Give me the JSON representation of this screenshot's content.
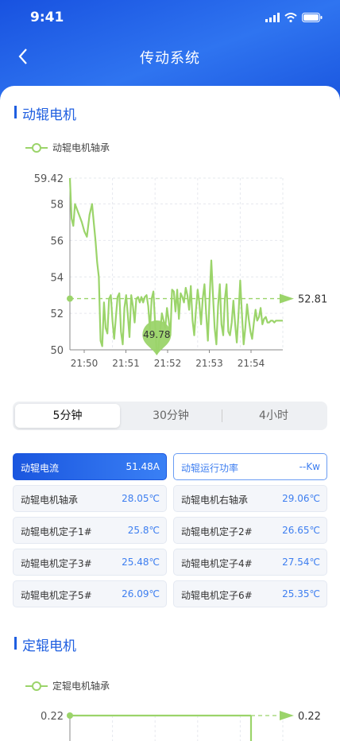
{
  "status_bar": {
    "time": "9:41"
  },
  "nav": {
    "title": "传动系统"
  },
  "section1": {
    "title": "动辊电机",
    "legend": "动辊电机轴承",
    "chart_data": {
      "type": "line",
      "series": [
        {
          "name": "动辊电机轴承",
          "x": [
            0,
            0.2,
            0.4,
            0.6,
            1.0,
            1.4,
            1.7,
            2.0,
            2.3,
            2.6,
            2.8,
            3.0,
            3.2,
            3.4,
            3.6,
            3.8,
            4.0,
            4.2,
            4.4,
            4.6,
            4.8,
            5.0,
            5.2,
            5.4,
            5.6,
            5.8,
            6.0,
            6.2,
            6.4,
            6.6,
            6.8,
            7.0,
            7.2,
            7.4,
            7.6,
            7.8,
            8.0,
            8.2,
            8.4,
            8.6,
            8.8,
            9.0,
            9.2,
            9.4,
            9.6,
            9.8,
            10.0,
            10.2,
            10.4,
            10.6,
            10.8,
            11.0,
            11.2,
            11.4,
            11.6,
            11.8,
            12.0,
            12.2,
            12.4,
            12.6,
            12.8,
            13.0,
            13.2,
            13.4,
            13.6,
            13.8,
            14.0,
            14.2,
            14.4,
            14.6,
            14.8,
            15.0,
            15.2,
            15.4,
            15.6,
            15.8,
            16.0,
            16.2,
            16.4,
            16.6,
            16.8,
            17.0,
            17.2,
            17.4,
            17.6,
            17.8,
            18.0,
            18.2,
            18.4,
            18.6,
            18.8,
            19.0,
            19.2,
            19.4,
            19.6,
            19.8,
            20.0,
            20.2,
            20.4,
            20.6,
            20.8,
            21.0,
            21.2,
            21.4,
            21.6,
            21.8,
            22.0,
            22.2,
            22.4,
            22.6,
            22.8,
            23.0,
            23.2,
            23.4,
            23.6,
            23.8,
            24.0,
            24.2,
            24.4,
            24.6,
            24.8,
            25.0
          ],
          "values": [
            59.42,
            57.2,
            56.8,
            58.0,
            57.5,
            57.0,
            56.5,
            56.2,
            57.4,
            58.0,
            57.0,
            56.0,
            54.8,
            54.0,
            50.5,
            50.2,
            52.6,
            51.2,
            50.9,
            52.8,
            53.0,
            51.6,
            50.6,
            51.8,
            52.9,
            53.1,
            51.0,
            50.3,
            52.3,
            53.0,
            51.9,
            50.7,
            53.0,
            52.4,
            51.5,
            52.8,
            52.9,
            52.6,
            52.9,
            52.6,
            52.9,
            53.0,
            52.4,
            51.1,
            52.8,
            53.2,
            51.5,
            49.78,
            50.1,
            51.0,
            52.0,
            51.6,
            51.2,
            52.3,
            51.6,
            50.8,
            53.3,
            53.2,
            52.1,
            53.3,
            51.7,
            53.1,
            52.9,
            52.6,
            53.4,
            53.0,
            52.2,
            53.5,
            51.6,
            50.8,
            52.2,
            53.3,
            52.6,
            51.4,
            52.8,
            53.6,
            52.0,
            50.5,
            52.8,
            54.9,
            53.0,
            51.2,
            50.3,
            52.4,
            53.6,
            51.4,
            50.8,
            52.8,
            53.6,
            51.0,
            50.8,
            51.5,
            52.7,
            51.4,
            50.4,
            52.0,
            53.8,
            52.0,
            50.3,
            51.2,
            52.5,
            51.7,
            51.0,
            50.6,
            51.5,
            52.2,
            51.6,
            51.8,
            52.3,
            51.4,
            51.7,
            51.8,
            51.5,
            51.5,
            51.6,
            51.6,
            51.5,
            51.6,
            51.6,
            51.6,
            51.6,
            51.6,
            51.6
          ]
        }
      ],
      "xticks": [
        "21:50",
        "21:51",
        "21:52",
        "21:53",
        "21:54"
      ],
      "yticks": [
        "50",
        "52",
        "54",
        "56",
        "58",
        "59.42"
      ],
      "ylim": [
        50,
        59.42
      ],
      "markLine": "52.81",
      "minLabel": "49.78"
    }
  },
  "tabs": [
    "5分钟",
    "30分钟",
    "4小时"
  ],
  "metrics": [
    {
      "label": "动辊电流",
      "value": "51.48A"
    },
    {
      "label": "动辊运行功率",
      "value": "--Kw"
    },
    {
      "label": "动辊电机轴承",
      "value": "28.05℃"
    },
    {
      "label": "动辊电机右轴承",
      "value": "29.06℃"
    },
    {
      "label": "动辊电机定子1#",
      "value": "25.8℃"
    },
    {
      "label": "动辊电机定子2#",
      "value": "26.65℃"
    },
    {
      "label": "动辊电机定子3#",
      "value": "25.48℃"
    },
    {
      "label": "动辊电机定子4#",
      "value": "27.54℃"
    },
    {
      "label": "动辊电机定子5#",
      "value": "26.09℃"
    },
    {
      "label": "动辊电机定子6#",
      "value": "25.35℃"
    }
  ],
  "section2": {
    "title": "定辊电机",
    "legend": "定辊电机轴承",
    "chart_data": {
      "type": "line",
      "series": [
        {
          "name": "定辊电机轴承",
          "values": [
            0.22,
            0.22
          ]
        }
      ],
      "yticks": [
        "0.22"
      ],
      "markLine": "0.22"
    }
  },
  "colors": {
    "primary": "#1f5fe0",
    "series": "#9bd46a",
    "value": "#3d7ef0"
  }
}
